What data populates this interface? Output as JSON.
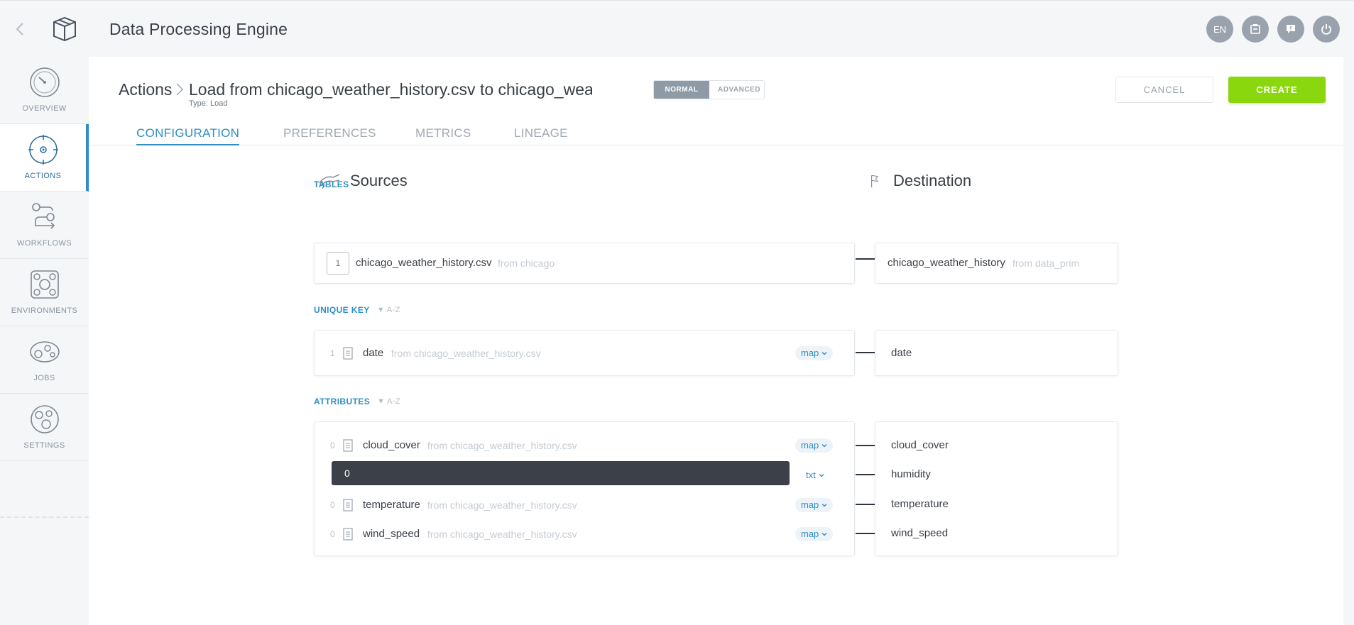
{
  "app": {
    "title": "Data Processing Engine"
  },
  "topbar": {
    "lang": "EN",
    "icons": [
      "back-chevron-icon",
      "box-logo-icon",
      "clipboard-icon",
      "chat-icon",
      "power-icon"
    ]
  },
  "nav": {
    "items": [
      {
        "key": "overview",
        "label": "OVERVIEW",
        "icon": "gauge-icon"
      },
      {
        "key": "actions",
        "label": "ACTIONS",
        "icon": "target-icon",
        "active": true
      },
      {
        "key": "workflows",
        "label": "WORKFLOWS",
        "icon": "flow-icon"
      },
      {
        "key": "environments",
        "label": "ENVIRONMENTS",
        "icon": "network-icon"
      },
      {
        "key": "jobs",
        "label": "JOBS",
        "icon": "gears-icon"
      },
      {
        "key": "settings",
        "label": "SETTINGS",
        "icon": "cog-icon"
      }
    ]
  },
  "header": {
    "breadcrumb_root": "Actions",
    "breadcrumb_current": "Load from chicago_weather_history.csv to chicago_weather_history",
    "type_label": "Type: Load",
    "mode_normal": "NORMAL",
    "mode_advanced": "ADVANCED",
    "cancel": "CANCEL",
    "create": "CREATE"
  },
  "tabs": [
    {
      "label": "CONFIGURATION",
      "active": true
    },
    {
      "label": "PREFERENCES"
    },
    {
      "label": "METRICS"
    },
    {
      "label": "LINEAGE"
    }
  ],
  "content": {
    "sources_title": "Sources",
    "destination_title": "Destination",
    "tables_label": "TABLES",
    "unique_key_label": "UNIQUE KEY",
    "attributes_label": "ATTRIBUTES",
    "sort_label": "A-Z",
    "table": {
      "number": "1",
      "source_name": "chicago_weather_history.csv",
      "source_from": "from chicago",
      "dest_name": "chicago_weather_history",
      "dest_from": "from data_prim"
    },
    "unique_key": {
      "number": "1",
      "source_name": "date",
      "source_from": "from chicago_weather_history.csv",
      "mapping": "map",
      "dest_name": "date"
    },
    "attributes": [
      {
        "number": "0",
        "source_name": "cloud_cover",
        "source_from": "from chicago_weather_history.csv",
        "mapping": "map",
        "dest_name": "cloud_cover"
      },
      {
        "value": "0",
        "mapping": "txt",
        "dest_name": "humidity"
      },
      {
        "number": "0",
        "source_name": "temperature",
        "source_from": "from chicago_weather_history.csv",
        "mapping": "map",
        "dest_name": "temperature"
      },
      {
        "number": "0",
        "source_name": "wind_speed",
        "source_from": "from chicago_weather_history.csv",
        "mapping": "map",
        "dest_name": "wind_speed"
      }
    ]
  },
  "colors": {
    "accent": "#2f8ec5",
    "create": "#8bd70e",
    "toggle_active": "#8f9aa7",
    "dark_input": "#3b4049"
  }
}
